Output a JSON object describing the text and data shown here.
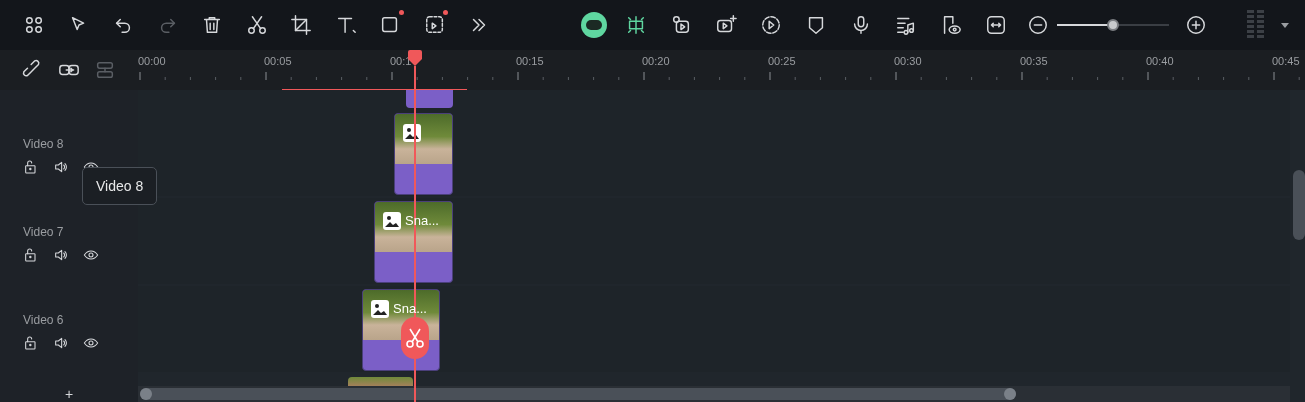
{
  "ruler": {
    "labels": [
      "00:00",
      "00:05",
      "00:1",
      "00:15",
      "00:20",
      "00:25",
      "00:30",
      "00:35",
      "00:40",
      "00:45"
    ]
  },
  "zoom_slider": {
    "level": 0.5
  },
  "tracks": [
    {
      "name": "Video 8",
      "selected": false
    },
    {
      "name": "Video 7",
      "clip_label": "Sna...",
      "selected": false
    },
    {
      "name": "Video 6",
      "clip_label": "Sna...",
      "selected": false
    }
  ],
  "tooltip": {
    "text": "Video 8"
  },
  "add_track": {
    "label": "+"
  }
}
